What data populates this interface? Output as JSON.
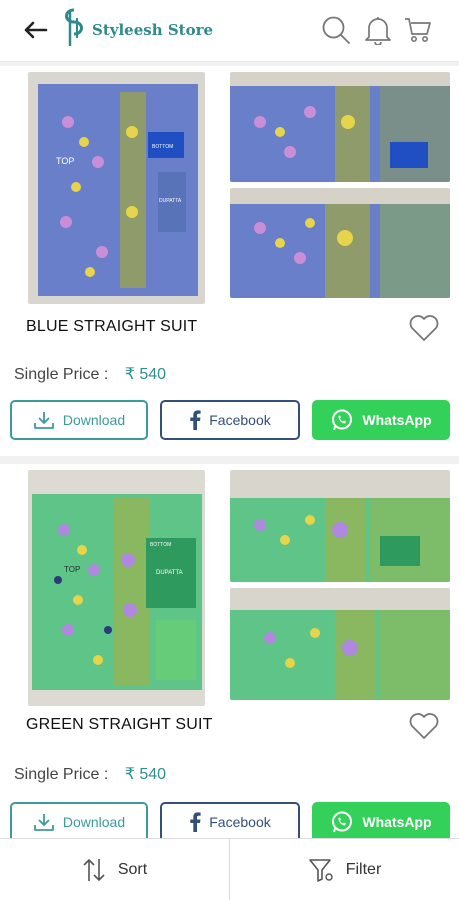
{
  "header": {
    "back_icon": "arrow-left-icon",
    "logo_text": "Styleesh Store",
    "search_icon": "search-icon",
    "bell_icon": "bell-icon",
    "cart_icon": "cart-icon"
  },
  "products": [
    {
      "title": "BLUE STRAIGHT SUIT",
      "price_label": "Single Price :",
      "price": "₹ 540",
      "buttons": {
        "download": "Download",
        "facebook": "Facebook",
        "whatsapp": "WhatsApp"
      },
      "image_labels": {
        "top": "TOP",
        "bottom": "BOTTOM",
        "dupatta": "DUPATTA"
      },
      "colors": {
        "fabric": "#6a7fc9",
        "border": "#8f9b6a"
      }
    },
    {
      "title": "GREEN STRAIGHT SUIT",
      "price_label": "Single Price :",
      "price": "₹ 540",
      "buttons": {
        "download": "Download",
        "facebook": "Facebook",
        "whatsapp": "WhatsApp"
      },
      "image_labels": {
        "top": "TOP",
        "bottom": "BOTTOM",
        "dupatta": "DUPATTA"
      },
      "colors": {
        "fabric": "#5fc487",
        "border": "#8ab860"
      }
    }
  ],
  "bottom_bar": {
    "sort": "Sort",
    "filter": "Filter"
  },
  "colors": {
    "accent": "#2f8f91",
    "facebook": "#33507a",
    "whatsapp": "#34d15a"
  }
}
